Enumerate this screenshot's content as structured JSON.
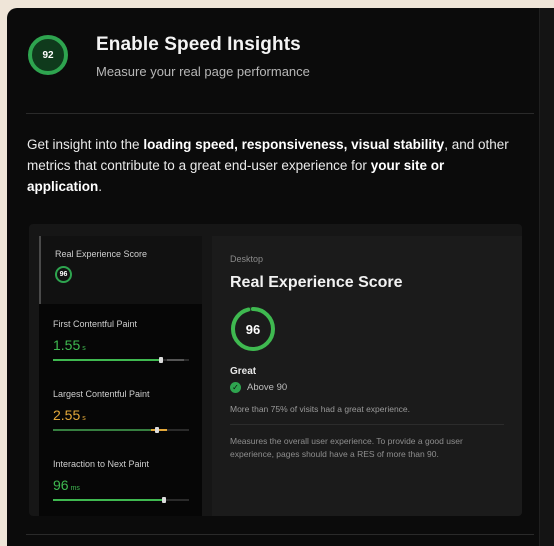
{
  "header": {
    "badge_score": "92",
    "title": "Enable Speed Insights",
    "subtitle": "Measure your real page performance"
  },
  "intro": {
    "part1": "Get insight into the ",
    "bold1": "loading speed, responsiveness, visual stability",
    "part2": ", and other metrics that contribute to a great end-user experience for ",
    "bold2": "your site or application",
    "part3": "."
  },
  "preview": {
    "sidebar": [
      {
        "label": "Real Experience Score",
        "value": "96",
        "unit": "",
        "status": "good"
      },
      {
        "label": "First Contentful Paint",
        "value": "1.55",
        "unit": "s",
        "status": "good",
        "level": 0.78
      },
      {
        "label": "Largest Contentful Paint",
        "value": "2.55",
        "unit": "s",
        "status": "needs-improvement",
        "level": 0.75
      },
      {
        "label": "Interaction to Next Paint",
        "value": "96",
        "unit": "ms",
        "status": "good",
        "level": 0.8
      }
    ],
    "main": {
      "device": "Desktop",
      "title": "Real Experience Score",
      "score": "96",
      "score_fraction": 0.96,
      "rating": "Great",
      "threshold": "Above 90",
      "visits": "More than 75% of visits had a great experience.",
      "description": "Measures the overall user experience. To provide a good user experience, pages should have a RES of more than 90."
    }
  },
  "colors": {
    "good": "#3fb950",
    "needs_improvement": "#e3a83a",
    "background": "#0b0b0b"
  }
}
